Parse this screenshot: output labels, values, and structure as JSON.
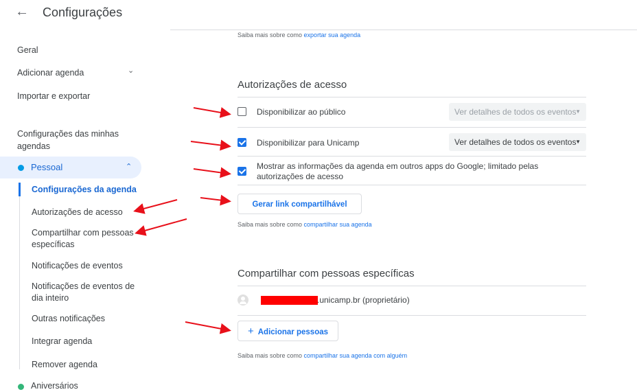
{
  "header": {
    "back_icon": "←",
    "title": "Configurações"
  },
  "sidebar": {
    "items": [
      {
        "label": "Geral"
      },
      {
        "label": "Adicionar agenda",
        "chevron": "⌄"
      },
      {
        "label": "Importar e exportar"
      }
    ],
    "section_heading": "Configurações das minhas agendas",
    "calendar": {
      "label": "Pessoal",
      "color": "#039be5",
      "chevron": "⌃"
    },
    "subitems": [
      {
        "label": "Configurações da agenda",
        "active": true
      },
      {
        "label": "Autorizações de acesso"
      },
      {
        "label": "Compartilhar com pessoas específicas"
      },
      {
        "label": "Notificações de eventos"
      },
      {
        "label": "Notificações de eventos de dia inteiro"
      },
      {
        "label": "Outras notificações"
      },
      {
        "label": "Integrar agenda"
      },
      {
        "label": "Remover agenda"
      }
    ],
    "other_calendar": {
      "label": "Aniversários",
      "color": "#33b679"
    }
  },
  "export_help": {
    "prefix": "Saiba mais sobre como ",
    "link": "exportar sua agenda"
  },
  "access": {
    "title": "Autorizações de acesso",
    "rows": [
      {
        "label": "Disponibilizar ao público",
        "checked": false,
        "select": "Ver detalhes de todos os eventos",
        "enabled": false
      },
      {
        "label": "Disponibilizar para Unicamp",
        "checked": true,
        "select": "Ver detalhes de todos os eventos",
        "enabled": true
      },
      {
        "label": "Mostrar as informações da agenda em outros apps do Google; limitado pelas autorizações de acesso",
        "checked": true
      }
    ],
    "link_button": "Gerar link compartilhável",
    "help": {
      "prefix": "Saiba mais sobre como ",
      "link": "compartilhar sua agenda"
    }
  },
  "share": {
    "title": "Compartilhar com pessoas específicas",
    "person": {
      "email_suffix": ".unicamp.br (proprietário)"
    },
    "add_button": {
      "icon": "+",
      "label": "Adicionar pessoas"
    },
    "help": {
      "prefix": "Saiba mais sobre como ",
      "link": "compartilhar sua agenda com alguém"
    }
  },
  "colors": {
    "accent": "#1a73e8",
    "arrow": "#e8101a",
    "redaction": "#ff0000"
  }
}
